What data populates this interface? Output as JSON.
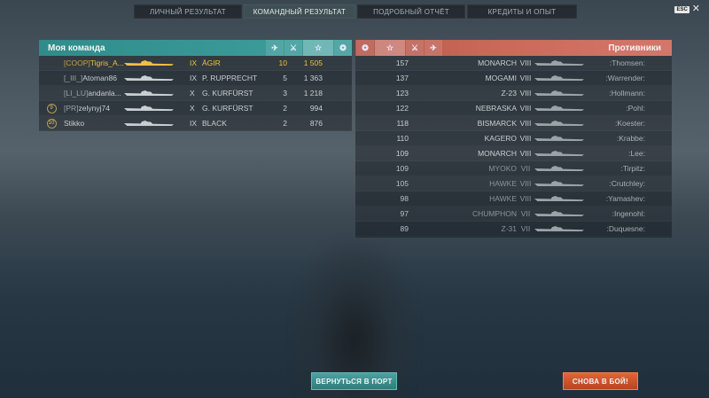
{
  "tabs": [
    {
      "label": "ЛИЧНЫЙ РЕЗУЛЬТАТ",
      "active": false
    },
    {
      "label": "КОМАНДНЫЙ РЕЗУЛЬТАТ",
      "active": true
    },
    {
      "label": "ПОДРОБНЫЙ ОТЧЁТ",
      "active": false
    },
    {
      "label": "КРЕДИТЫ И ОПЫТ",
      "active": false
    }
  ],
  "esc": {
    "key": "ESC",
    "close": "✕"
  },
  "my_team": {
    "title": "Моя команда",
    "color": "#2f8c8a",
    "rows": [
      {
        "badge": "",
        "clan": "[COOP]",
        "name": "Tigris_A...",
        "tier": "IX",
        "ship": "ÄGIR",
        "kills": "10",
        "xp": "1 505",
        "highlight": true
      },
      {
        "badge": "",
        "clan": "[_III_]",
        "name": "Atoman86",
        "tier": "IX",
        "ship": "P. RUPPRECHT",
        "kills": "5",
        "xp": "1 363",
        "highlight": false
      },
      {
        "badge": "",
        "clan": "[LI_LU]",
        "name": "andanla...",
        "tier": "X",
        "ship": "G. KURFÜRST",
        "kills": "3",
        "xp": "1 218",
        "highlight": false
      },
      {
        "badge": "9",
        "clan": "[PR]",
        "name": "zelynyj74",
        "tier": "X",
        "ship": "G. KURFÜRST",
        "kills": "2",
        "xp": "994",
        "highlight": false
      },
      {
        "badge": "10",
        "clan": "",
        "name": "Stikko",
        "tier": "IX",
        "ship": "BLACK",
        "kills": "2",
        "xp": "876",
        "highlight": false
      }
    ]
  },
  "enemies": {
    "title": "Противники",
    "color": "#c86858",
    "rows": [
      {
        "xp": "157",
        "ship": "MONARCH",
        "tier": "VIII",
        "player": ":Thomsen:"
      },
      {
        "xp": "137",
        "ship": "MOGAMI",
        "tier": "VIII",
        "player": ":Warrender:"
      },
      {
        "xp": "123",
        "ship": "Z-23",
        "tier": "VIII",
        "player": ":Hollmann:"
      },
      {
        "xp": "122",
        "ship": "NEBRASKA",
        "tier": "VIII",
        "player": ":Pohl:"
      },
      {
        "xp": "118",
        "ship": "BISMARCK",
        "tier": "VIII",
        "player": ":Koester:"
      },
      {
        "xp": "110",
        "ship": "KAGERO",
        "tier": "VIII",
        "player": ":Krabbe:"
      },
      {
        "xp": "109",
        "ship": "MONARCH",
        "tier": "VIII",
        "player": ":Lee:"
      },
      {
        "xp": "109",
        "ship": "MYOKO",
        "tier": "VII",
        "player": ":Tirpitz:"
      },
      {
        "xp": "105",
        "ship": "HAWKE",
        "tier": "VIII",
        "player": ":Crutchley:"
      },
      {
        "xp": "98",
        "ship": "HAWKE",
        "tier": "VIII",
        "player": ":Yamashev:"
      },
      {
        "xp": "97",
        "ship": "CHUMPHON",
        "tier": "VII",
        "player": ":Ingenohl:"
      },
      {
        "xp": "89",
        "ship": "Z-31",
        "tier": "VII",
        "player": ":Duquesne:"
      }
    ]
  },
  "buttons": {
    "port": "ВЕРНУТЬСЯ В ПОРТ",
    "battle": "СНОВА В БОЙ!"
  },
  "icons": {
    "planes_shot": "plane-icon",
    "ships_killed": "crossed-swords-icon",
    "experience": "star-icon",
    "laurel": "laurel-icon"
  }
}
